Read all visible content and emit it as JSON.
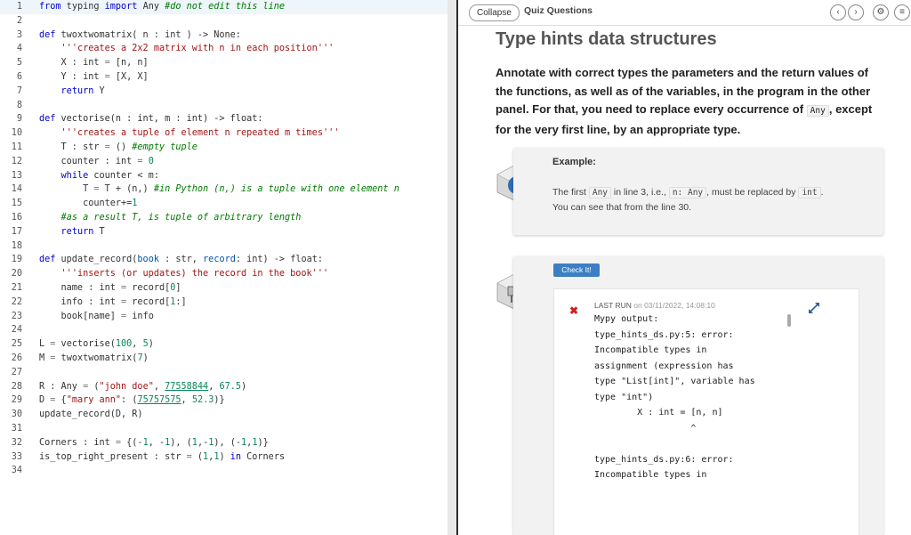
{
  "editor": {
    "lines": [
      {
        "n": "1",
        "html": "<span class=\"kw\">from</span> typing <span class=\"kw\">import</span> Any <span class=\"cm\">#do not edit this line</span>"
      },
      {
        "n": "2",
        "html": ""
      },
      {
        "n": "3",
        "html": "<span class=\"kw\">def</span> twoxtwomatrix( n : int ) -> None:"
      },
      {
        "n": "4",
        "html": "    <span class=\"st\">'''creates a 2x2 matrix with n in each position'''</span>"
      },
      {
        "n": "5",
        "html": "    X : int <span class=\"op\">=</span> [n, n]"
      },
      {
        "n": "6",
        "html": "    Y : int <span class=\"op\">=</span> [X, X]"
      },
      {
        "n": "7",
        "html": "    <span class=\"kw\">return</span> Y"
      },
      {
        "n": "8",
        "html": ""
      },
      {
        "n": "9",
        "html": "<span class=\"kw\">def</span> vectorise(n : int, m : int) -> float:"
      },
      {
        "n": "10",
        "html": "    <span class=\"st\">'''creates a tuple of element n repeated m times'''</span>"
      },
      {
        "n": "11",
        "html": "    T : str <span class=\"op\">=</span> () <span class=\"cm\">#empty tuple</span>"
      },
      {
        "n": "12",
        "html": "    counter : int <span class=\"op\">=</span> <span class=\"nm\">0</span>"
      },
      {
        "n": "13",
        "html": "    <span class=\"kw\">while</span> counter &lt; m:"
      },
      {
        "n": "14",
        "html": "        T <span class=\"op\">=</span> T + (n,) <span class=\"cm\">#in Python (n,) is a tuple with one element n</span>"
      },
      {
        "n": "15",
        "html": "        counter+=<span class=\"nm\">1</span>"
      },
      {
        "n": "16",
        "html": "    <span class=\"cm\">#as a result T, is tuple of arbitrary length</span>"
      },
      {
        "n": "17",
        "html": "    <span class=\"kw\">return</span> T"
      },
      {
        "n": "18",
        "html": ""
      },
      {
        "n": "19",
        "html": "<span class=\"kw\">def</span> update_record(<span class=\"kw2\">book</span> : str, <span class=\"kw2\">record</span>: int) -> float:"
      },
      {
        "n": "20",
        "html": "    <span class=\"st\">'''inserts (or updates) the record in the book'''</span>"
      },
      {
        "n": "21",
        "html": "    name : int <span class=\"op\">=</span> record[<span class=\"nm\">0</span>]"
      },
      {
        "n": "22",
        "html": "    info : int <span class=\"op\">=</span> record[<span class=\"nm\">1</span>:]"
      },
      {
        "n": "23",
        "html": "    book[name] <span class=\"op\">=</span> info"
      },
      {
        "n": "24",
        "html": ""
      },
      {
        "n": "25",
        "html": "L <span class=\"op\">=</span> vectorise(<span class=\"nm\">100</span>, <span class=\"nm\">5</span>)"
      },
      {
        "n": "26",
        "html": "M <span class=\"op\">=</span> twoxtwomatrix(<span class=\"nm\">7</span>)"
      },
      {
        "n": "27",
        "html": ""
      },
      {
        "n": "28",
        "html": "R : Any <span class=\"op\">=</span> (<span class=\"st\">\"john doe\"</span>, <span class=\"ul\">77558844</span>, <span class=\"nm\">67.5</span>)"
      },
      {
        "n": "29",
        "html": "D <span class=\"op\">=</span> {<span class=\"st\">\"mary ann\"</span>: (<span class=\"ul\">75757575</span>, <span class=\"nm\">52.3</span>)}"
      },
      {
        "n": "30",
        "html": "update_record(D, R)"
      },
      {
        "n": "31",
        "html": ""
      },
      {
        "n": "32",
        "html": "Corners : int <span class=\"op\">=</span> {(-<span class=\"nm\">1</span>, -<span class=\"nm\">1</span>), (<span class=\"nm\">1</span>,-<span class=\"nm\">1</span>), (-<span class=\"nm\">1</span>,<span class=\"nm\">1</span>)}"
      },
      {
        "n": "33",
        "html": "is_top_right_present : str <span class=\"op\">=</span> (<span class=\"nm\">1</span>,<span class=\"nm\">1</span>) <span class=\"kw\">in</span> Corners"
      },
      {
        "n": "34",
        "html": ""
      }
    ]
  },
  "topbar": {
    "collapse_label": "Collapse",
    "breadcrumb": "Quiz Questions",
    "prev_icon": "chevron-left-icon",
    "next_icon": "chevron-right-icon",
    "settings_icon": "gear-icon",
    "menu_icon": "list-icon"
  },
  "main": {
    "title": "Type hints data structures",
    "intro_part1": "Annotate with correct types the parameters and the return values of the functions, as well as of the variables, in the program in the other panel. For that, you need to replace every occurrence of ",
    "intro_code": "Any",
    "intro_part2": ", except for the very first line, by an appropriate type."
  },
  "example": {
    "title": "Example:",
    "t1": "The first ",
    "c1": "Any",
    "t2": " in line 3, i.e., ",
    "c2": "n: Any",
    "t3": ", must be replaced by ",
    "c3": "int",
    "t4": ".",
    "line2": "You can see that from the line 30.",
    "icon": "info-icon"
  },
  "check": {
    "button_label": "Check It!",
    "status_icon": "close-icon",
    "last_run_label": "LAST RUN",
    "last_run_date": " on 03/11/2022, 14:08:10",
    "output": "Mypy output:\ntype_hints_ds.py:5: error:\nIncompatible types in\nassignment (expression has\ntype \"List[int]\", variable has\ntype \"int\")\n        X : int = [n, n]\n                  ^\n\ntype_hints_ds.py:6: error:\nIncompatible types in"
  },
  "colors": {
    "check_button": "#3b7fc4",
    "error_x": "#cc2222",
    "keyword": "#0000cc",
    "comment": "#007a00"
  }
}
